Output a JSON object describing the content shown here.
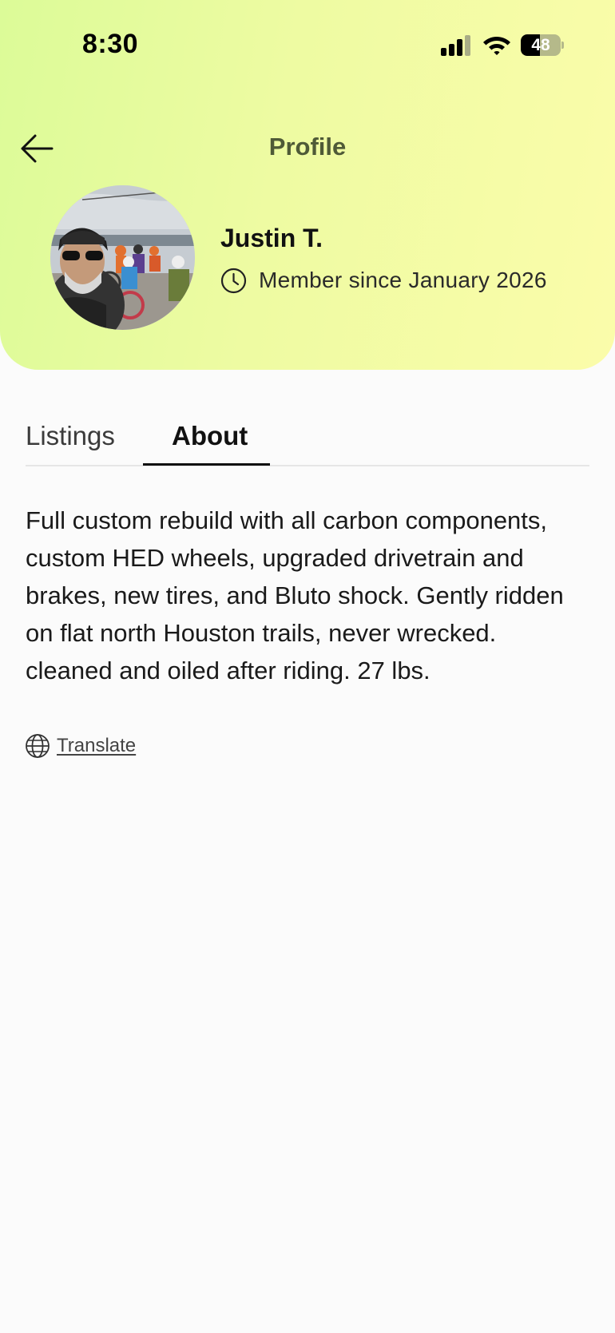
{
  "status_bar": {
    "time": "8:30",
    "battery_level": "48",
    "battery_fraction": 0.48
  },
  "header": {
    "title": "Profile",
    "gradient_colors": [
      "#dcfb98",
      "#fbfcaa"
    ]
  },
  "profile": {
    "name": "Justin T.",
    "member_since": "Member since January 2026"
  },
  "tabs": [
    {
      "label": "Listings",
      "active": false
    },
    {
      "label": "About",
      "active": true
    }
  ],
  "about": {
    "text": "Full custom rebuild with all carbon components, custom HED wheels, upgraded drivetrain and brakes, new tires, and Bluto shock. Gently ridden on flat north Houston trails, never wrecked. cleaned and oiled after riding. 27 lbs.",
    "translate_label": "Translate"
  },
  "icons": {
    "back": "arrow-left-icon",
    "clock": "clock-icon",
    "translate": "globe-icon",
    "signal": "cellular-signal-icon",
    "wifi": "wifi-icon",
    "battery": "battery-icon"
  }
}
